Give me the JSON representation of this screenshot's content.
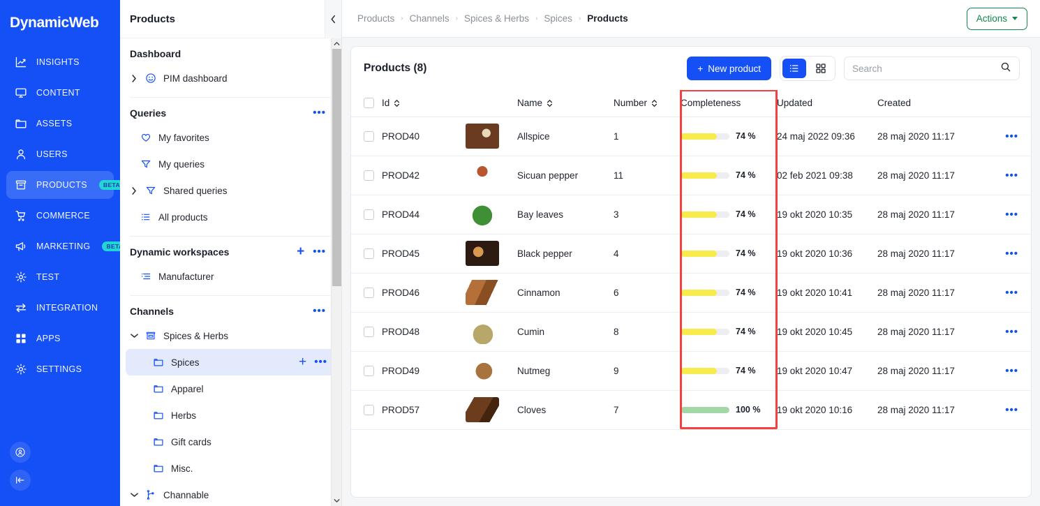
{
  "brand": {
    "name": "DynamicWeb",
    "accent": "#1450f5",
    "beta_color": "#23d6d6",
    "green": "#13864b",
    "highlight": "#f5403f"
  },
  "rail": {
    "items": [
      {
        "label": "INSIGHTS",
        "icon": "chart-icon",
        "badge": "",
        "active": false
      },
      {
        "label": "CONTENT",
        "icon": "monitor-icon",
        "badge": "",
        "active": false
      },
      {
        "label": "ASSETS",
        "icon": "folder-icon",
        "badge": "",
        "active": false
      },
      {
        "label": "USERS",
        "icon": "user-icon",
        "badge": "",
        "active": false
      },
      {
        "label": "PRODUCTS",
        "icon": "box-icon",
        "badge": "BETA",
        "active": true
      },
      {
        "label": "COMMERCE",
        "icon": "cart-icon",
        "badge": "",
        "active": false
      },
      {
        "label": "MARKETING",
        "icon": "megaphone-icon",
        "badge": "BETA",
        "active": false
      },
      {
        "label": "TEST",
        "icon": "gear-icon",
        "badge": "",
        "active": false
      },
      {
        "label": "INTEGRATION",
        "icon": "exchange-icon",
        "badge": "",
        "active": false
      },
      {
        "label": "APPS",
        "icon": "grid-icon",
        "badge": "",
        "active": false
      },
      {
        "label": "SETTINGS",
        "icon": "gear-icon",
        "badge": "",
        "active": false
      }
    ],
    "bottom": [
      {
        "icon": "account-icon"
      },
      {
        "icon": "collapse-rail-icon"
      }
    ]
  },
  "subnav": {
    "title": "Products",
    "collapse_icon": "chevron-left-icon",
    "sections": [
      {
        "heading": "Dashboard",
        "has_menu": false,
        "has_add": false,
        "items": [
          {
            "label": "PIM dashboard",
            "icon": "pim-dashboard-icon",
            "caret": "chevron-right-icon",
            "indent": 0,
            "selected": false,
            "add": false,
            "menu": false
          }
        ]
      },
      {
        "heading": "Queries",
        "has_menu": true,
        "has_add": false,
        "items": [
          {
            "label": "My favorites",
            "icon": "heart-icon",
            "caret": "",
            "indent": 1,
            "selected": false,
            "add": false,
            "menu": false
          },
          {
            "label": "My queries",
            "icon": "filter-icon",
            "caret": "",
            "indent": 1,
            "selected": false,
            "add": false,
            "menu": false
          },
          {
            "label": "Shared queries",
            "icon": "filter-icon",
            "caret": "chevron-right-icon",
            "indent": 0,
            "selected": false,
            "add": false,
            "menu": false
          },
          {
            "label": "All products",
            "icon": "list-icon",
            "caret": "",
            "indent": 1,
            "selected": false,
            "add": false,
            "menu": false
          }
        ]
      },
      {
        "heading": "Dynamic workspaces",
        "has_menu": true,
        "has_add": true,
        "items": [
          {
            "label": "Manufacturer",
            "icon": "workspace-icon",
            "caret": "",
            "indent": 1,
            "selected": false,
            "add": false,
            "menu": false
          }
        ]
      },
      {
        "heading": "Channels",
        "has_menu": true,
        "has_add": false,
        "items": [
          {
            "label": "Spices & Herbs",
            "icon": "shop-icon",
            "caret": "chevron-down-icon",
            "indent": 0,
            "selected": false,
            "add": false,
            "menu": false
          },
          {
            "label": "Spices",
            "icon": "folder-icon",
            "caret": "",
            "indent": 2,
            "selected": true,
            "add": true,
            "menu": true
          },
          {
            "label": "Apparel",
            "icon": "folder-icon",
            "caret": "",
            "indent": 2,
            "selected": false,
            "add": false,
            "menu": false
          },
          {
            "label": "Herbs",
            "icon": "folder-icon",
            "caret": "",
            "indent": 2,
            "selected": false,
            "add": false,
            "menu": false
          },
          {
            "label": "Gift cards",
            "icon": "folder-icon",
            "caret": "",
            "indent": 2,
            "selected": false,
            "add": false,
            "menu": false
          },
          {
            "label": "Misc.",
            "icon": "folder-icon",
            "caret": "",
            "indent": 2,
            "selected": false,
            "add": false,
            "menu": false
          },
          {
            "label": "Channable",
            "icon": "branch-icon",
            "caret": "chevron-down-icon",
            "indent": 0,
            "selected": false,
            "add": false,
            "menu": false
          }
        ]
      }
    ],
    "menu_glyph": "•••",
    "add_glyph": "+"
  },
  "topbar": {
    "breadcrumbs": [
      "Products",
      "Channels",
      "Spices & Herbs",
      "Spices",
      "Products"
    ],
    "separator": "›",
    "actions_label": "Actions"
  },
  "toolbar": {
    "card_title": "Products (8)",
    "new_product_label": "New product",
    "new_product_plus": "+",
    "view_list_icon": "list-view-icon",
    "view_grid_icon": "grid-view-icon",
    "active_view": "list",
    "search_placeholder": "Search",
    "search_value": "",
    "search_icon": "search-icon"
  },
  "table": {
    "columns": [
      {
        "key": "checkbox",
        "label": "",
        "sortable": false
      },
      {
        "key": "id",
        "label": "Id",
        "sortable": true
      },
      {
        "key": "thumb",
        "label": "",
        "sortable": false
      },
      {
        "key": "name",
        "label": "Name",
        "sortable": true
      },
      {
        "key": "number",
        "label": "Number",
        "sortable": true
      },
      {
        "key": "completeness",
        "label": "Completeness",
        "sortable": false
      },
      {
        "key": "updated",
        "label": "Updated",
        "sortable": false
      },
      {
        "key": "created",
        "label": "Created",
        "sortable": false
      },
      {
        "key": "menu",
        "label": "",
        "sortable": false
      }
    ],
    "highlighted_column": "completeness",
    "row_menu_glyph": "•••",
    "rows": [
      {
        "id": "PROD40",
        "name": "Allspice",
        "number": "1",
        "completeness": 74,
        "completeness_label": "74 %",
        "bar_color": "#f7ec4b",
        "updated": "24 maj 2022 09:36",
        "created": "28 maj 2020 11:17",
        "thumb": "allspice"
      },
      {
        "id": "PROD42",
        "name": "Sicuan pepper",
        "number": "11",
        "completeness": 74,
        "completeness_label": "74 %",
        "bar_color": "#f7ec4b",
        "updated": "02 feb 2021 09:38",
        "created": "28 maj 2020 11:17",
        "thumb": "sicuan"
      },
      {
        "id": "PROD44",
        "name": "Bay leaves",
        "number": "3",
        "completeness": 74,
        "completeness_label": "74 %",
        "bar_color": "#f7ec4b",
        "updated": "19 okt 2020 10:35",
        "created": "28 maj 2020 11:17",
        "thumb": "bay"
      },
      {
        "id": "PROD45",
        "name": "Black pepper",
        "number": "4",
        "completeness": 74,
        "completeness_label": "74 %",
        "bar_color": "#f7ec4b",
        "updated": "19 okt 2020 10:36",
        "created": "28 maj 2020 11:17",
        "thumb": "blackpepper"
      },
      {
        "id": "PROD46",
        "name": "Cinnamon",
        "number": "6",
        "completeness": 74,
        "completeness_label": "74 %",
        "bar_color": "#f7ec4b",
        "updated": "19 okt 2020 10:41",
        "created": "28 maj 2020 11:17",
        "thumb": "cinnamon"
      },
      {
        "id": "PROD48",
        "name": "Cumin",
        "number": "8",
        "completeness": 74,
        "completeness_label": "74 %",
        "bar_color": "#f7ec4b",
        "updated": "19 okt 2020 10:45",
        "created": "28 maj 2020 11:17",
        "thumb": "cumin"
      },
      {
        "id": "PROD49",
        "name": "Nutmeg",
        "number": "9",
        "completeness": 74,
        "completeness_label": "74 %",
        "bar_color": "#f7ec4b",
        "updated": "19 okt 2020 10:47",
        "created": "28 maj 2020 11:17",
        "thumb": "nutmeg"
      },
      {
        "id": "PROD57",
        "name": "Cloves",
        "number": "7",
        "completeness": 100,
        "completeness_label": "100 %",
        "bar_color": "#a4d7a7",
        "updated": "19 okt 2020 10:16",
        "created": "28 maj 2020 11:17",
        "thumb": "cloves"
      }
    ]
  }
}
